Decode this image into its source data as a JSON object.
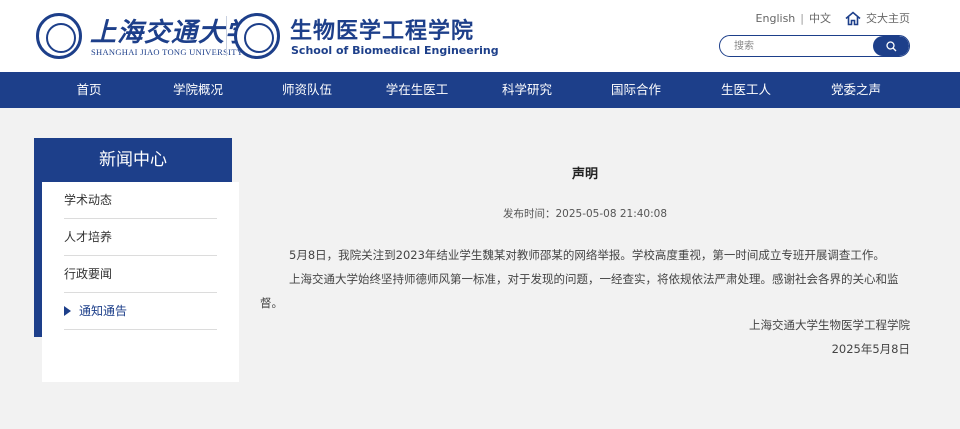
{
  "header": {
    "university_cn": "上海交通大学",
    "university_en": "SHANGHAI JIAO TONG UNIVERSITY",
    "school_cn": "生物医学工程学院",
    "school_en": "School of Biomedical Engineering",
    "lang_en": "English",
    "lang_sep": "|",
    "lang_cn": "中文",
    "home_link": "交大主页",
    "home_icon": "home-icon",
    "search_placeholder": "搜索",
    "search_icon": "search-icon",
    "brand_color": "#1d3f8a"
  },
  "nav": {
    "items": [
      {
        "label": "首页"
      },
      {
        "label": "学院概况"
      },
      {
        "label": "师资队伍"
      },
      {
        "label": "学在生医工"
      },
      {
        "label": "科学研究"
      },
      {
        "label": "国际合作"
      },
      {
        "label": "生医工人"
      },
      {
        "label": "党委之声"
      }
    ]
  },
  "sidebar": {
    "title": "新闻中心",
    "items": [
      {
        "label": "学术动态"
      },
      {
        "label": "人才培养"
      },
      {
        "label": "行政要闻"
      },
      {
        "label": "通知通告",
        "active": true
      }
    ]
  },
  "article": {
    "title": "声明",
    "date": "发布时间：2025-05-08 21:40:08",
    "paragraphs": [
      "5月8日，我院关注到2023年结业学生魏某对教师邵某的网络举报。学校高度重视，第一时间成立专班开展调查工作。",
      "上海交通大学始终坚持师德师风第一标准，对于发现的问题，一经查实，将依规依法严肃处理。感谢社会各界的关心和监督。"
    ],
    "signature": "上海交通大学生物医学工程学院",
    "sign_date": "2025年5月8日"
  }
}
